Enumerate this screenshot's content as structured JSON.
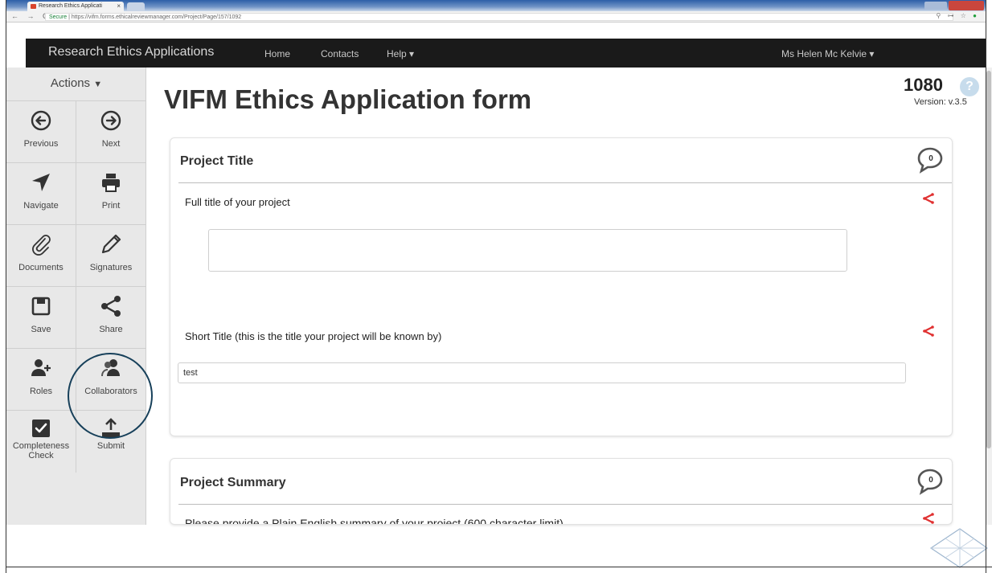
{
  "browser": {
    "tab_title": "Research Ethics Applicati",
    "tab_close": "×",
    "nav_buttons": "← → C",
    "secure_label": "Secure",
    "url": "https://vifm.forms.ethicalreviewmanager.com/Project/Page/157/1092",
    "addr_icons": "⚲ ⊶ ☆"
  },
  "navbar": {
    "brand": "Research Ethics Applications",
    "links": [
      "Home",
      "Contacts",
      "Help ▾"
    ],
    "user": "Ms Helen Mc Kelvie ▾"
  },
  "sidebar": {
    "header": "Actions",
    "actions": [
      {
        "label": "Previous",
        "icon": "arrow-left-circle-icon"
      },
      {
        "label": "Next",
        "icon": "arrow-right-circle-icon"
      },
      {
        "label": "Navigate",
        "icon": "navigate-arrow-icon"
      },
      {
        "label": "Print",
        "icon": "printer-icon"
      },
      {
        "label": "Documents",
        "icon": "paperclip-icon"
      },
      {
        "label": "Signatures",
        "icon": "pencil-icon"
      },
      {
        "label": "Save",
        "icon": "floppy-disk-icon"
      },
      {
        "label": "Share",
        "icon": "share-icon"
      },
      {
        "label": "Roles",
        "icon": "user-add-icon"
      },
      {
        "label": "Collaborators",
        "icon": "users-icon"
      },
      {
        "label": "Completeness Check",
        "icon": "checkbox-icon"
      },
      {
        "label": "Submit",
        "icon": "upload-icon"
      }
    ]
  },
  "main": {
    "title": "VIFM Ethics Application form",
    "application_number": "1080",
    "help_icon": "?",
    "version": "Version: v.3.5",
    "panels": [
      {
        "title": "Project Title",
        "comment_count": "0",
        "questions": [
          {
            "label": "Full title of your project",
            "value": ""
          },
          {
            "label": "Short Title (this is the title your project will be known by)",
            "value": "test"
          }
        ]
      },
      {
        "title": "Project Summary",
        "comment_count": "0",
        "questions": [
          {
            "label": "Please provide a Plain English summary of your project (600 character limit)",
            "value": ""
          }
        ]
      }
    ]
  },
  "colors": {
    "navbar_bg": "#1a1a1a",
    "sidebar_bg": "#e8e8e8",
    "share_red": "#e03131",
    "highlight_circle": "#17405a"
  }
}
